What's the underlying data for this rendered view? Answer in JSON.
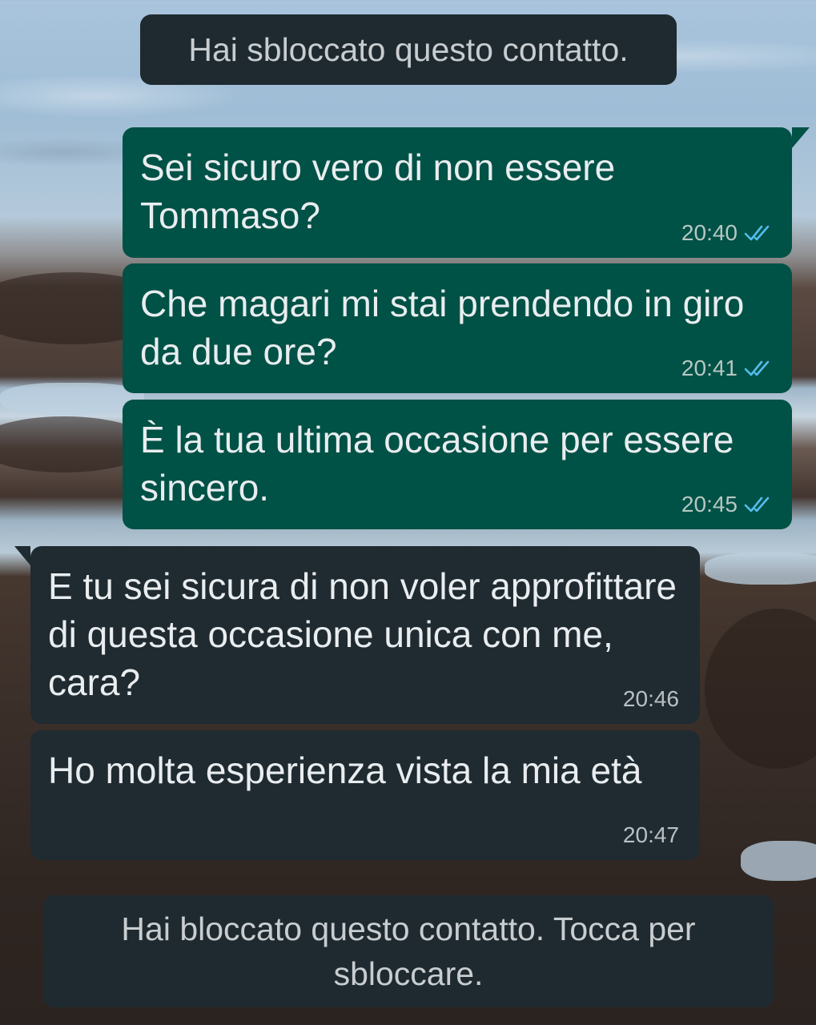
{
  "system_messages": {
    "unblocked": "Hai sbloccato questo contatto.",
    "blocked": "Hai bloccato questo contatto. Tocca per sbloccare."
  },
  "messages": [
    {
      "direction": "outgoing",
      "text": "Sei sicuro vero di non essere Tommaso?",
      "time": "20:40",
      "status": "read",
      "status_icon": "double-check-icon"
    },
    {
      "direction": "outgoing",
      "text": "Che magari mi stai prendendo in giro da due ore?",
      "time": "20:41",
      "status": "read",
      "status_icon": "double-check-icon"
    },
    {
      "direction": "outgoing",
      "text": "È la tua ultima occasione per essere sincero.",
      "time": "20:45",
      "status": "read",
      "status_icon": "double-check-icon"
    },
    {
      "direction": "incoming",
      "text": "E tu sei sicura di non voler approfittare di questa occasione unica con me, cara?",
      "time": "20:46"
    },
    {
      "direction": "incoming",
      "text": "Ho molta esperienza vista la mia età",
      "time": "20:47"
    }
  ],
  "colors": {
    "outgoing_bubble": "#005146",
    "incoming_bubble": "#1f2b31",
    "system_pill": "#1f2a30",
    "read_ticks": "#53bdeb"
  }
}
